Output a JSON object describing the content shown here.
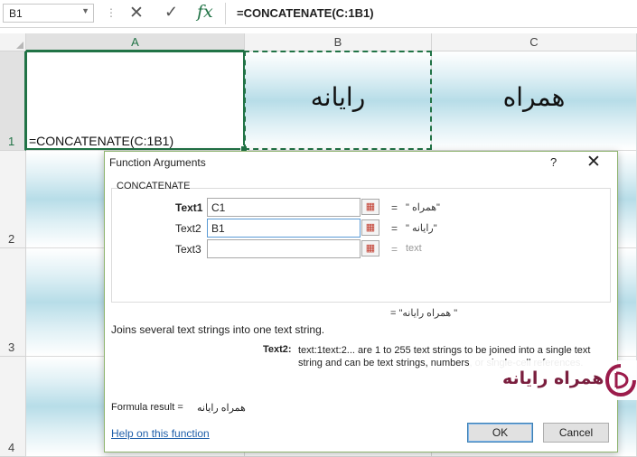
{
  "formula_bar": {
    "name_box": "B1",
    "formula": "=CONCATENATE(C:1B1)"
  },
  "grid": {
    "columns": [
      "A",
      "B",
      "C"
    ],
    "rows": [
      "1",
      "2",
      "3",
      "4"
    ],
    "cells": {
      "A1": "=CONCATENATE(C:1B1)",
      "B1": "رایانه",
      "C1": "همراه"
    }
  },
  "dialog": {
    "title": "Function Arguments",
    "help_glyph": "?",
    "close_glyph": "✕",
    "function_name": "CONCATENATE",
    "args": [
      {
        "label": "Text1",
        "value": "C1",
        "result": "\" همراه\""
      },
      {
        "label": "Text2",
        "value": "B1",
        "result": "\" رایانه\""
      },
      {
        "label": "Text3",
        "value": "",
        "result": "text"
      }
    ],
    "result_line": "= \"همراه رایانه \"",
    "description": "Joins several text strings into one text string.",
    "arg_help_name": "Text2:",
    "arg_help_text": "text:1text:2... are 1 to 255 text strings to be joined into a single text string and can be text strings, numbers, or single-cell references.",
    "formula_result_label": "Formula result =",
    "formula_result_value": "همراه رایانه",
    "help_link": "Help on this function",
    "ok_label": "OK",
    "cancel_label": "Cancel"
  },
  "watermark": {
    "text": "همراه رایانه",
    "colors": {
      "brand": "#7a1e3e",
      "logo": "#9b1b4b"
    }
  },
  "colors": {
    "accent": "#217346"
  }
}
